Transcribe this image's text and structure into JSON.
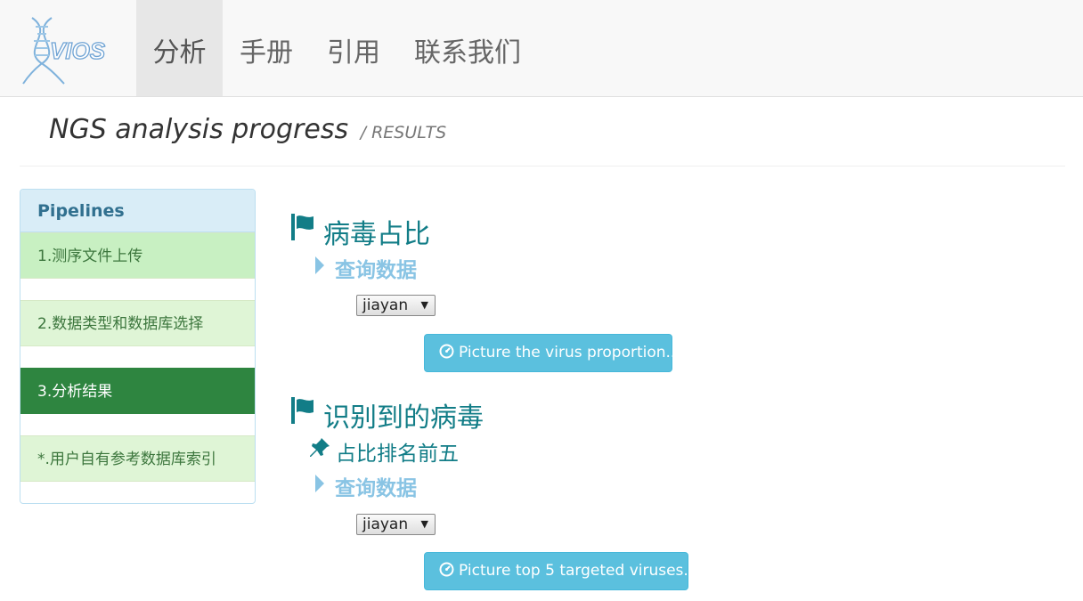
{
  "navbar": {
    "brand": "VIOS",
    "items": [
      {
        "label": "分析",
        "active": true
      },
      {
        "label": "手册",
        "active": false
      },
      {
        "label": "引用",
        "active": false
      },
      {
        "label": "联系我们",
        "active": false
      }
    ]
  },
  "header": {
    "title": "NGS analysis progress",
    "subtitle": "/ RESULTS"
  },
  "sidebar": {
    "heading": "Pipelines",
    "items": [
      {
        "label": "1.测序文件上传",
        "state": "done"
      },
      {
        "label": "2.数据类型和数据库选择",
        "state": "done"
      },
      {
        "label": "3.分析结果",
        "state": "active"
      },
      {
        "label": "*.用户自有参考数据库索引",
        "state": "done"
      }
    ]
  },
  "sections": [
    {
      "title": "病毒占比",
      "query_label": "查询数据",
      "select_value": "jiayan",
      "button_label": "Picture the virus proportion..."
    },
    {
      "title": "识别到的病毒",
      "pinned_label": "占比排名前五",
      "query_label": "查询数据",
      "select_value": "jiayan",
      "button_label": "Picture top 5 targeted viruses..."
    }
  ],
  "icons": {
    "flag": "flag-icon",
    "caret": "caret-right-icon",
    "pin": "pushpin-icon",
    "dashboard": "dashboard-icon"
  },
  "colors": {
    "accent_teal": "#127d87",
    "link_light_blue": "#89c4e4",
    "button_info": "#5bc0de",
    "active_green": "#2e8540",
    "panel_heading": "#d9edf7"
  }
}
